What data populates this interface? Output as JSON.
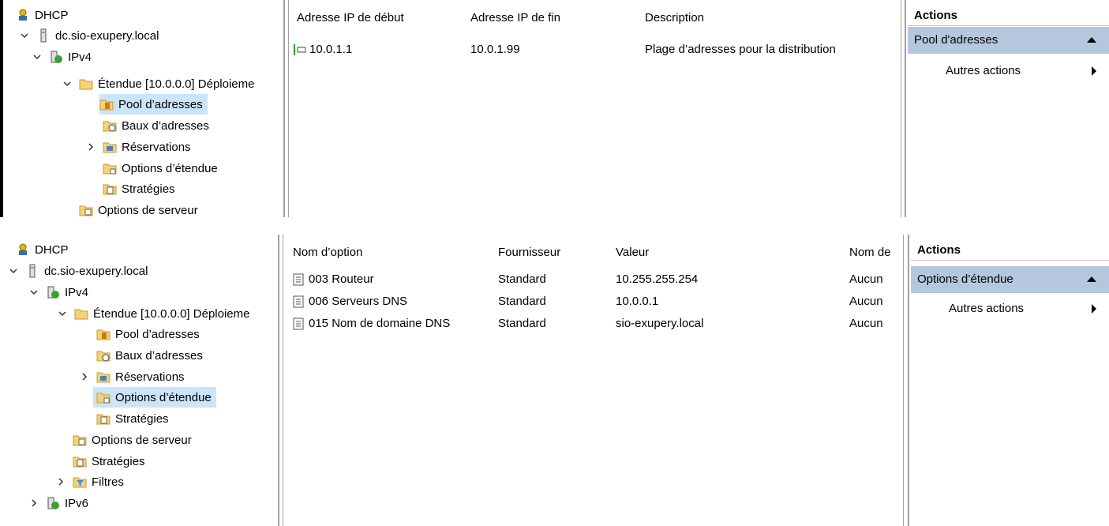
{
  "panel1": {
    "tree": [
      {
        "label": "DHCP",
        "icon": "dhcp-icon"
      },
      {
        "label": "dc.sio-exupery.local",
        "icon": "server-icon"
      },
      {
        "label": "IPv4",
        "icon": "ipv4-icon"
      },
      {
        "label": "Étendue [10.0.0.0] Déploieme",
        "icon": "folder-icon"
      },
      {
        "label": "Pool d’adresses",
        "icon": "address-pool-icon",
        "selected": true
      },
      {
        "label": "Baux d’adresses",
        "icon": "leases-icon"
      },
      {
        "label": "Réservations",
        "icon": "reservations-icon"
      },
      {
        "label": "Options d’étendue",
        "icon": "scope-options-icon"
      },
      {
        "label": "Stratégies",
        "icon": "policies-icon"
      },
      {
        "label": "Options de serveur",
        "icon": "server-options-icon"
      }
    ],
    "columns": [
      "Adresse IP de début",
      "Adresse IP de fin",
      "Description"
    ],
    "rows": [
      {
        "start": "10.0.1.1",
        "end": "10.0.1.99",
        "description": "Plage d’adresses pour la distribution"
      }
    ],
    "actions": {
      "title": "Actions",
      "header": "Pool d'adresses",
      "item": "Autres actions"
    }
  },
  "panel2": {
    "tree": [
      {
        "label": "DHCP",
        "icon": "dhcp-icon"
      },
      {
        "label": "dc.sio-exupery.local",
        "icon": "server-icon"
      },
      {
        "label": "IPv4",
        "icon": "ipv4-icon"
      },
      {
        "label": "Étendue [10.0.0.0] Déploieme",
        "icon": "folder-icon"
      },
      {
        "label": "Pool d’adresses",
        "icon": "address-pool-icon"
      },
      {
        "label": "Baux d’adresses",
        "icon": "leases-icon"
      },
      {
        "label": "Réservations",
        "icon": "reservations-icon"
      },
      {
        "label": "Options d’étendue",
        "icon": "scope-options-icon",
        "selected": true
      },
      {
        "label": "Stratégies",
        "icon": "policies-icon"
      },
      {
        "label": "Options de serveur",
        "icon": "server-options-icon"
      },
      {
        "label": "Stratégies",
        "icon": "policies-icon"
      },
      {
        "label": "Filtres",
        "icon": "filters-icon"
      },
      {
        "label": "IPv6",
        "icon": "ipv6-icon"
      }
    ],
    "columns": [
      "Nom d’option",
      "Fournisseur",
      "Valeur",
      "Nom de"
    ],
    "rows": [
      {
        "name": "003 Routeur",
        "vendor": "Standard",
        "value": "10.255.255.254",
        "class": "Aucun"
      },
      {
        "name": "006 Serveurs DNS",
        "vendor": "Standard",
        "value": "10.0.0.1",
        "class": "Aucun"
      },
      {
        "name": "015 Nom de domaine DNS",
        "vendor": "Standard",
        "value": "sio-exupery.local",
        "class": "Aucun"
      }
    ],
    "actions": {
      "title": "Actions",
      "header": "Options d’étendue",
      "item": "Autres actions"
    }
  }
}
